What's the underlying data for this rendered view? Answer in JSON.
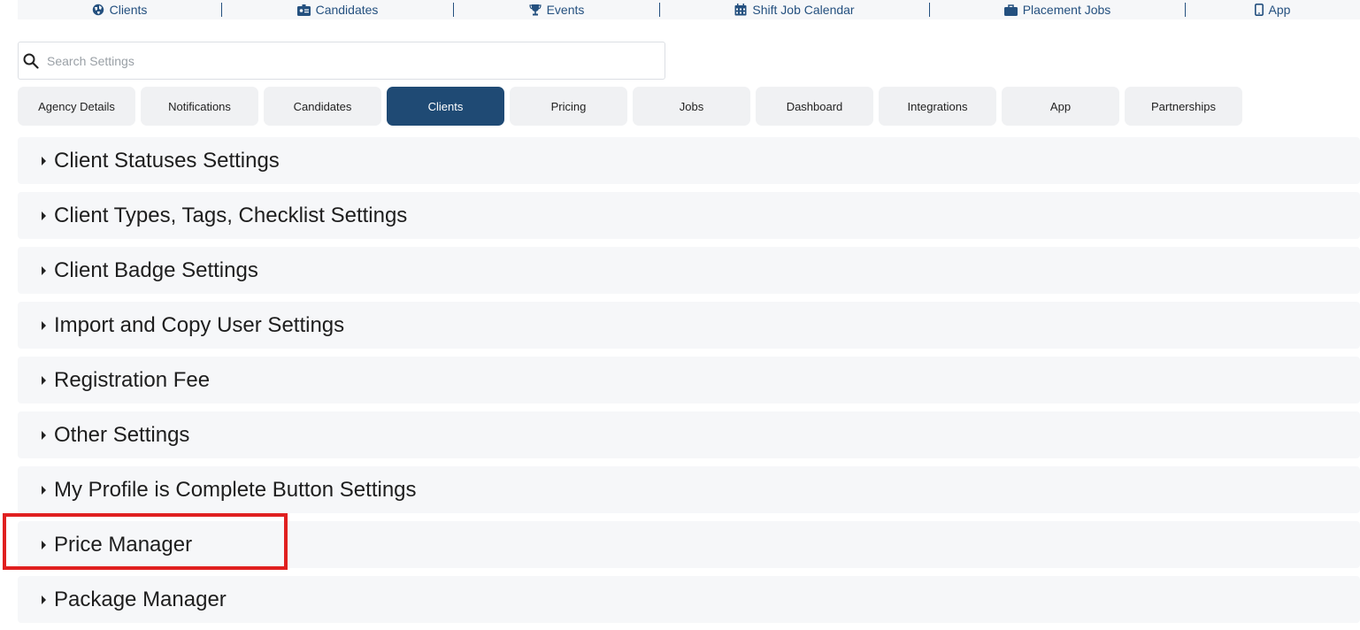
{
  "topnav": {
    "items": [
      {
        "label": "Clients",
        "icon": "globe-icon"
      },
      {
        "label": "Candidates",
        "icon": "id-card-icon"
      },
      {
        "label": "Events",
        "icon": "trophy-icon"
      },
      {
        "label": "Shift Job Calendar",
        "icon": "calendar-icon"
      },
      {
        "label": "Placement Jobs",
        "icon": "briefcase-icon"
      },
      {
        "label": "App",
        "icon": "mobile-icon"
      }
    ]
  },
  "search": {
    "placeholder": "Search Settings",
    "value": ""
  },
  "tabs": [
    {
      "label": "Agency Details",
      "active": false
    },
    {
      "label": "Notifications",
      "active": false
    },
    {
      "label": "Candidates",
      "active": false
    },
    {
      "label": "Clients",
      "active": true
    },
    {
      "label": "Pricing",
      "active": false
    },
    {
      "label": "Jobs",
      "active": false
    },
    {
      "label": "Dashboard",
      "active": false
    },
    {
      "label": "Integrations",
      "active": false
    },
    {
      "label": "App",
      "active": false
    },
    {
      "label": "Partnerships",
      "active": false
    }
  ],
  "sections": [
    {
      "label": "Client Statuses Settings"
    },
    {
      "label": "Client Types, Tags, Checklist Settings"
    },
    {
      "label": "Client Badge Settings"
    },
    {
      "label": "Import and Copy User Settings"
    },
    {
      "label": "Registration Fee"
    },
    {
      "label": "Other Settings"
    },
    {
      "label": "My Profile is Complete Button Settings"
    },
    {
      "label": "Price Manager"
    },
    {
      "label": "Package Manager"
    }
  ],
  "colors": {
    "accent": "#1f4a74",
    "nav_text": "#24507f",
    "highlight": "#e02020"
  }
}
